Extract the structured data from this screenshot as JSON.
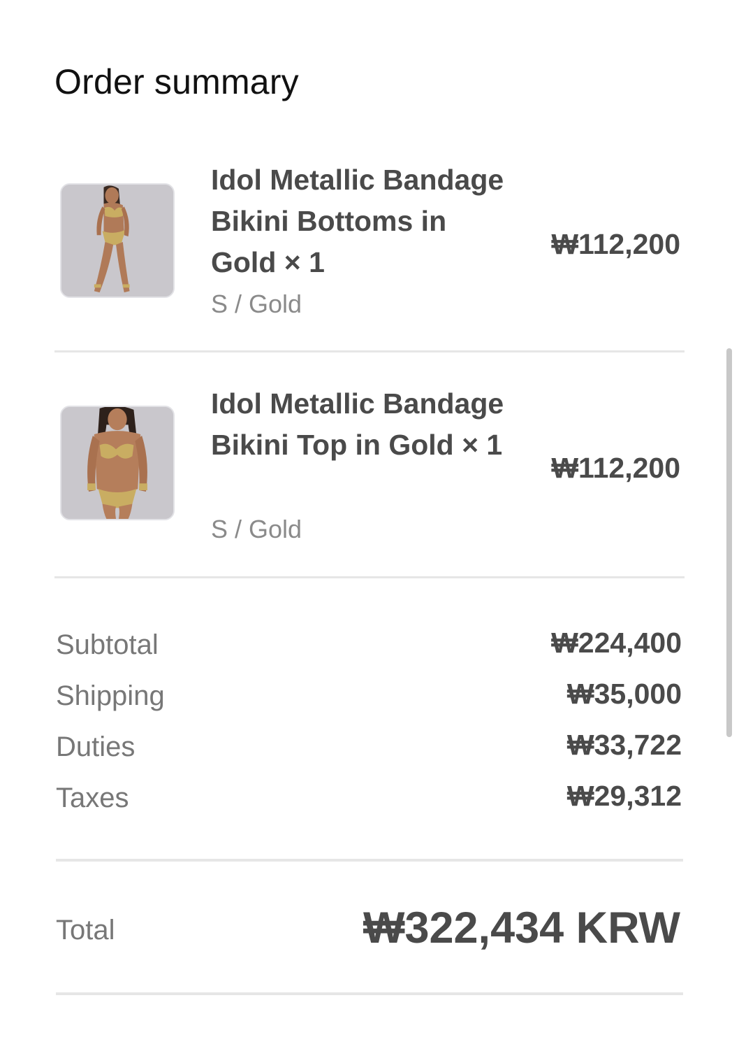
{
  "header": {
    "title": "Order summary"
  },
  "line_items": [
    {
      "name": "Idol Metallic Bandage Bikini Bottoms in Gold × 1",
      "variant": "S / Gold",
      "price": "₩112,200",
      "thumbnail_icon": "bikini-bottoms-product-image"
    },
    {
      "name": "Idol Metallic Bandage Bikini Top in Gold × 1",
      "variant": "S / Gold",
      "price": "₩112,200",
      "thumbnail_icon": "bikini-top-product-image"
    }
  ],
  "summary": {
    "subtotal_label": "Subtotal",
    "subtotal_value": "₩224,400",
    "shipping_label": "Shipping",
    "shipping_value": "₩35,000",
    "duties_label": "Duties",
    "duties_value": "₩33,722",
    "taxes_label": "Taxes",
    "taxes_value": "₩29,312"
  },
  "total": {
    "label": "Total",
    "value": "₩322,434 KRW"
  },
  "colors": {
    "background": "#ffffff",
    "text_primary": "#4a4a4a",
    "text_muted": "#777777",
    "divider": "#e6e6e6",
    "thumbnail_bg": "#c9c7cc",
    "product_gold": "#c9ad62"
  }
}
